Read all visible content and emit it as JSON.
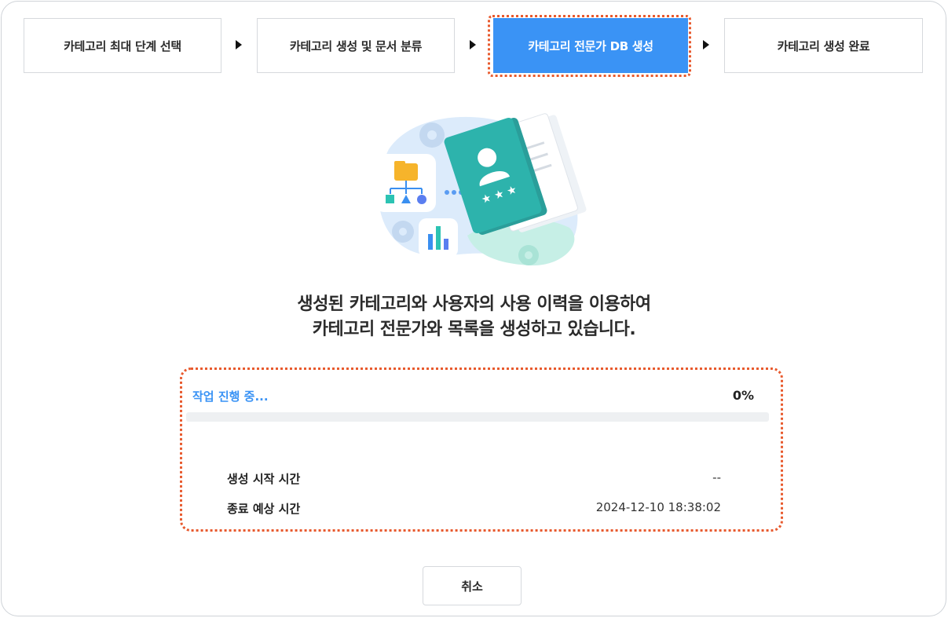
{
  "stepper": {
    "steps": [
      {
        "label": "카테고리 최대 단계 선택"
      },
      {
        "label": "카테고리 생성 및 문서 분류"
      },
      {
        "label": "카테고리 전문가 DB 생성"
      },
      {
        "label": "카테고리 생성 완료"
      }
    ],
    "active_step_index": 2
  },
  "illustration": {
    "icons": [
      "folder-tree-icon",
      "expert-book-icon",
      "bar-chart-icon",
      "gear-icon"
    ]
  },
  "message": {
    "line1": "생성된 카테고리와 사용자의 사용 이력을 이용하여",
    "line2": "카테고리 전문가와 목록을 생성하고 있습니다."
  },
  "progress": {
    "status_label": "작업 진행 중...",
    "percent_text": "0%",
    "fraction": 0.0,
    "rows": [
      {
        "label": "생성 시작 시간",
        "value": "--"
      },
      {
        "label": "종료 예상 시간",
        "value": "2024-12-10 18:38:02"
      }
    ]
  },
  "actions": {
    "cancel_label": "취소"
  },
  "colors": {
    "accent": "#3a93f5",
    "highlight": "#e85a2e"
  }
}
